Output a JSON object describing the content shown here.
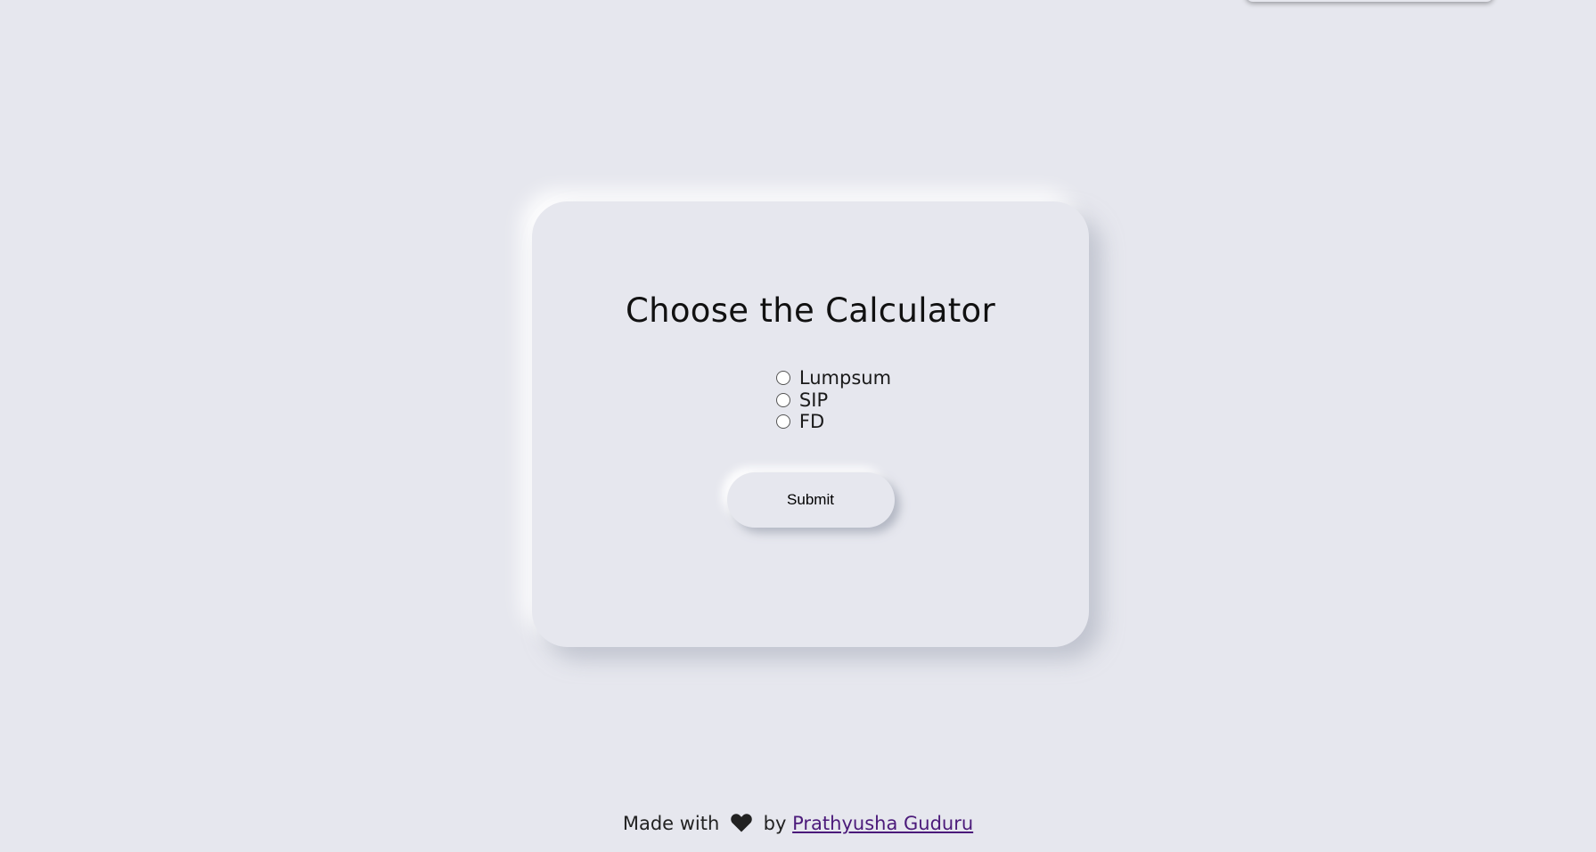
{
  "card": {
    "title": "Choose the Calculator",
    "options": [
      {
        "label": "Lumpsum",
        "selected": false
      },
      {
        "label": "SIP",
        "selected": false
      },
      {
        "label": "FD",
        "selected": false
      }
    ],
    "submit_label": "Submit"
  },
  "footer": {
    "prefix": "Made with",
    "icon": "heart-icon",
    "middle": "by",
    "author": "Prathyusha Guduru"
  },
  "colors": {
    "background": "#e6e7ee",
    "link": "#4b1a7a",
    "heart": "#222222"
  }
}
